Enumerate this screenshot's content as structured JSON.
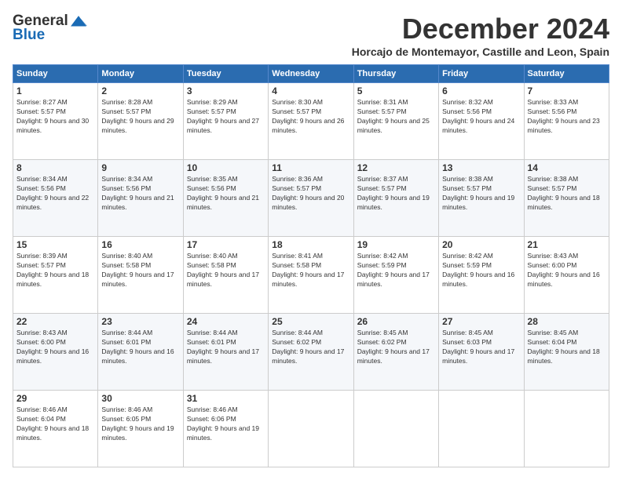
{
  "header": {
    "logo_general": "General",
    "logo_blue": "Blue",
    "month_title": "December 2024",
    "subtitle": "Horcajo de Montemayor, Castille and Leon, Spain"
  },
  "days_of_week": [
    "Sunday",
    "Monday",
    "Tuesday",
    "Wednesday",
    "Thursday",
    "Friday",
    "Saturday"
  ],
  "weeks": [
    [
      {
        "day": "1",
        "sunrise": "Sunrise: 8:27 AM",
        "sunset": "Sunset: 5:57 PM",
        "daylight": "Daylight: 9 hours and 30 minutes."
      },
      {
        "day": "2",
        "sunrise": "Sunrise: 8:28 AM",
        "sunset": "Sunset: 5:57 PM",
        "daylight": "Daylight: 9 hours and 29 minutes."
      },
      {
        "day": "3",
        "sunrise": "Sunrise: 8:29 AM",
        "sunset": "Sunset: 5:57 PM",
        "daylight": "Daylight: 9 hours and 27 minutes."
      },
      {
        "day": "4",
        "sunrise": "Sunrise: 8:30 AM",
        "sunset": "Sunset: 5:57 PM",
        "daylight": "Daylight: 9 hours and 26 minutes."
      },
      {
        "day": "5",
        "sunrise": "Sunrise: 8:31 AM",
        "sunset": "Sunset: 5:57 PM",
        "daylight": "Daylight: 9 hours and 25 minutes."
      },
      {
        "day": "6",
        "sunrise": "Sunrise: 8:32 AM",
        "sunset": "Sunset: 5:56 PM",
        "daylight": "Daylight: 9 hours and 24 minutes."
      },
      {
        "day": "7",
        "sunrise": "Sunrise: 8:33 AM",
        "sunset": "Sunset: 5:56 PM",
        "daylight": "Daylight: 9 hours and 23 minutes."
      }
    ],
    [
      {
        "day": "8",
        "sunrise": "Sunrise: 8:34 AM",
        "sunset": "Sunset: 5:56 PM",
        "daylight": "Daylight: 9 hours and 22 minutes."
      },
      {
        "day": "9",
        "sunrise": "Sunrise: 8:34 AM",
        "sunset": "Sunset: 5:56 PM",
        "daylight": "Daylight: 9 hours and 21 minutes."
      },
      {
        "day": "10",
        "sunrise": "Sunrise: 8:35 AM",
        "sunset": "Sunset: 5:56 PM",
        "daylight": "Daylight: 9 hours and 21 minutes."
      },
      {
        "day": "11",
        "sunrise": "Sunrise: 8:36 AM",
        "sunset": "Sunset: 5:57 PM",
        "daylight": "Daylight: 9 hours and 20 minutes."
      },
      {
        "day": "12",
        "sunrise": "Sunrise: 8:37 AM",
        "sunset": "Sunset: 5:57 PM",
        "daylight": "Daylight: 9 hours and 19 minutes."
      },
      {
        "day": "13",
        "sunrise": "Sunrise: 8:38 AM",
        "sunset": "Sunset: 5:57 PM",
        "daylight": "Daylight: 9 hours and 19 minutes."
      },
      {
        "day": "14",
        "sunrise": "Sunrise: 8:38 AM",
        "sunset": "Sunset: 5:57 PM",
        "daylight": "Daylight: 9 hours and 18 minutes."
      }
    ],
    [
      {
        "day": "15",
        "sunrise": "Sunrise: 8:39 AM",
        "sunset": "Sunset: 5:57 PM",
        "daylight": "Daylight: 9 hours and 18 minutes."
      },
      {
        "day": "16",
        "sunrise": "Sunrise: 8:40 AM",
        "sunset": "Sunset: 5:58 PM",
        "daylight": "Daylight: 9 hours and 17 minutes."
      },
      {
        "day": "17",
        "sunrise": "Sunrise: 8:40 AM",
        "sunset": "Sunset: 5:58 PM",
        "daylight": "Daylight: 9 hours and 17 minutes."
      },
      {
        "day": "18",
        "sunrise": "Sunrise: 8:41 AM",
        "sunset": "Sunset: 5:58 PM",
        "daylight": "Daylight: 9 hours and 17 minutes."
      },
      {
        "day": "19",
        "sunrise": "Sunrise: 8:42 AM",
        "sunset": "Sunset: 5:59 PM",
        "daylight": "Daylight: 9 hours and 17 minutes."
      },
      {
        "day": "20",
        "sunrise": "Sunrise: 8:42 AM",
        "sunset": "Sunset: 5:59 PM",
        "daylight": "Daylight: 9 hours and 16 minutes."
      },
      {
        "day": "21",
        "sunrise": "Sunrise: 8:43 AM",
        "sunset": "Sunset: 6:00 PM",
        "daylight": "Daylight: 9 hours and 16 minutes."
      }
    ],
    [
      {
        "day": "22",
        "sunrise": "Sunrise: 8:43 AM",
        "sunset": "Sunset: 6:00 PM",
        "daylight": "Daylight: 9 hours and 16 minutes."
      },
      {
        "day": "23",
        "sunrise": "Sunrise: 8:44 AM",
        "sunset": "Sunset: 6:01 PM",
        "daylight": "Daylight: 9 hours and 16 minutes."
      },
      {
        "day": "24",
        "sunrise": "Sunrise: 8:44 AM",
        "sunset": "Sunset: 6:01 PM",
        "daylight": "Daylight: 9 hours and 17 minutes."
      },
      {
        "day": "25",
        "sunrise": "Sunrise: 8:44 AM",
        "sunset": "Sunset: 6:02 PM",
        "daylight": "Daylight: 9 hours and 17 minutes."
      },
      {
        "day": "26",
        "sunrise": "Sunrise: 8:45 AM",
        "sunset": "Sunset: 6:02 PM",
        "daylight": "Daylight: 9 hours and 17 minutes."
      },
      {
        "day": "27",
        "sunrise": "Sunrise: 8:45 AM",
        "sunset": "Sunset: 6:03 PM",
        "daylight": "Daylight: 9 hours and 17 minutes."
      },
      {
        "day": "28",
        "sunrise": "Sunrise: 8:45 AM",
        "sunset": "Sunset: 6:04 PM",
        "daylight": "Daylight: 9 hours and 18 minutes."
      }
    ],
    [
      {
        "day": "29",
        "sunrise": "Sunrise: 8:46 AM",
        "sunset": "Sunset: 6:04 PM",
        "daylight": "Daylight: 9 hours and 18 minutes."
      },
      {
        "day": "30",
        "sunrise": "Sunrise: 8:46 AM",
        "sunset": "Sunset: 6:05 PM",
        "daylight": "Daylight: 9 hours and 19 minutes."
      },
      {
        "day": "31",
        "sunrise": "Sunrise: 8:46 AM",
        "sunset": "Sunset: 6:06 PM",
        "daylight": "Daylight: 9 hours and 19 minutes."
      },
      null,
      null,
      null,
      null
    ]
  ]
}
